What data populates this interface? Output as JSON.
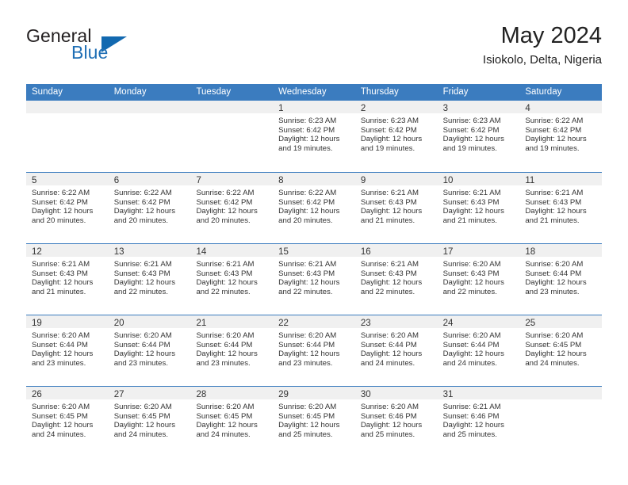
{
  "brand": {
    "word_general": "General",
    "word_blue": "Blue",
    "triangle_color": "#1269b0",
    "blue_color": "#1f6fb5"
  },
  "header": {
    "title": "May 2024",
    "location": "Isiokolo, Delta, Nigeria"
  },
  "theme": {
    "header_blue": "#3b7cbf",
    "daynum_band": "#f0f0f0",
    "text": "#333333"
  },
  "calendar": {
    "weekday_headers": [
      "Sunday",
      "Monday",
      "Tuesday",
      "Wednesday",
      "Thursday",
      "Friday",
      "Saturday"
    ],
    "weeks": [
      [
        {
          "day": "",
          "sunrise": "",
          "sunset": "",
          "daylight1": "",
          "daylight2": ""
        },
        {
          "day": "",
          "sunrise": "",
          "sunset": "",
          "daylight1": "",
          "daylight2": ""
        },
        {
          "day": "",
          "sunrise": "",
          "sunset": "",
          "daylight1": "",
          "daylight2": ""
        },
        {
          "day": "1",
          "sunrise": "Sunrise: 6:23 AM",
          "sunset": "Sunset: 6:42 PM",
          "daylight1": "Daylight: 12 hours",
          "daylight2": "and 19 minutes."
        },
        {
          "day": "2",
          "sunrise": "Sunrise: 6:23 AM",
          "sunset": "Sunset: 6:42 PM",
          "daylight1": "Daylight: 12 hours",
          "daylight2": "and 19 minutes."
        },
        {
          "day": "3",
          "sunrise": "Sunrise: 6:23 AM",
          "sunset": "Sunset: 6:42 PM",
          "daylight1": "Daylight: 12 hours",
          "daylight2": "and 19 minutes."
        },
        {
          "day": "4",
          "sunrise": "Sunrise: 6:22 AM",
          "sunset": "Sunset: 6:42 PM",
          "daylight1": "Daylight: 12 hours",
          "daylight2": "and 19 minutes."
        }
      ],
      [
        {
          "day": "5",
          "sunrise": "Sunrise: 6:22 AM",
          "sunset": "Sunset: 6:42 PM",
          "daylight1": "Daylight: 12 hours",
          "daylight2": "and 20 minutes."
        },
        {
          "day": "6",
          "sunrise": "Sunrise: 6:22 AM",
          "sunset": "Sunset: 6:42 PM",
          "daylight1": "Daylight: 12 hours",
          "daylight2": "and 20 minutes."
        },
        {
          "day": "7",
          "sunrise": "Sunrise: 6:22 AM",
          "sunset": "Sunset: 6:42 PM",
          "daylight1": "Daylight: 12 hours",
          "daylight2": "and 20 minutes."
        },
        {
          "day": "8",
          "sunrise": "Sunrise: 6:22 AM",
          "sunset": "Sunset: 6:42 PM",
          "daylight1": "Daylight: 12 hours",
          "daylight2": "and 20 minutes."
        },
        {
          "day": "9",
          "sunrise": "Sunrise: 6:21 AM",
          "sunset": "Sunset: 6:43 PM",
          "daylight1": "Daylight: 12 hours",
          "daylight2": "and 21 minutes."
        },
        {
          "day": "10",
          "sunrise": "Sunrise: 6:21 AM",
          "sunset": "Sunset: 6:43 PM",
          "daylight1": "Daylight: 12 hours",
          "daylight2": "and 21 minutes."
        },
        {
          "day": "11",
          "sunrise": "Sunrise: 6:21 AM",
          "sunset": "Sunset: 6:43 PM",
          "daylight1": "Daylight: 12 hours",
          "daylight2": "and 21 minutes."
        }
      ],
      [
        {
          "day": "12",
          "sunrise": "Sunrise: 6:21 AM",
          "sunset": "Sunset: 6:43 PM",
          "daylight1": "Daylight: 12 hours",
          "daylight2": "and 21 minutes."
        },
        {
          "day": "13",
          "sunrise": "Sunrise: 6:21 AM",
          "sunset": "Sunset: 6:43 PM",
          "daylight1": "Daylight: 12 hours",
          "daylight2": "and 22 minutes."
        },
        {
          "day": "14",
          "sunrise": "Sunrise: 6:21 AM",
          "sunset": "Sunset: 6:43 PM",
          "daylight1": "Daylight: 12 hours",
          "daylight2": "and 22 minutes."
        },
        {
          "day": "15",
          "sunrise": "Sunrise: 6:21 AM",
          "sunset": "Sunset: 6:43 PM",
          "daylight1": "Daylight: 12 hours",
          "daylight2": "and 22 minutes."
        },
        {
          "day": "16",
          "sunrise": "Sunrise: 6:21 AM",
          "sunset": "Sunset: 6:43 PM",
          "daylight1": "Daylight: 12 hours",
          "daylight2": "and 22 minutes."
        },
        {
          "day": "17",
          "sunrise": "Sunrise: 6:20 AM",
          "sunset": "Sunset: 6:43 PM",
          "daylight1": "Daylight: 12 hours",
          "daylight2": "and 22 minutes."
        },
        {
          "day": "18",
          "sunrise": "Sunrise: 6:20 AM",
          "sunset": "Sunset: 6:44 PM",
          "daylight1": "Daylight: 12 hours",
          "daylight2": "and 23 minutes."
        }
      ],
      [
        {
          "day": "19",
          "sunrise": "Sunrise: 6:20 AM",
          "sunset": "Sunset: 6:44 PM",
          "daylight1": "Daylight: 12 hours",
          "daylight2": "and 23 minutes."
        },
        {
          "day": "20",
          "sunrise": "Sunrise: 6:20 AM",
          "sunset": "Sunset: 6:44 PM",
          "daylight1": "Daylight: 12 hours",
          "daylight2": "and 23 minutes."
        },
        {
          "day": "21",
          "sunrise": "Sunrise: 6:20 AM",
          "sunset": "Sunset: 6:44 PM",
          "daylight1": "Daylight: 12 hours",
          "daylight2": "and 23 minutes."
        },
        {
          "day": "22",
          "sunrise": "Sunrise: 6:20 AM",
          "sunset": "Sunset: 6:44 PM",
          "daylight1": "Daylight: 12 hours",
          "daylight2": "and 23 minutes."
        },
        {
          "day": "23",
          "sunrise": "Sunrise: 6:20 AM",
          "sunset": "Sunset: 6:44 PM",
          "daylight1": "Daylight: 12 hours",
          "daylight2": "and 24 minutes."
        },
        {
          "day": "24",
          "sunrise": "Sunrise: 6:20 AM",
          "sunset": "Sunset: 6:44 PM",
          "daylight1": "Daylight: 12 hours",
          "daylight2": "and 24 minutes."
        },
        {
          "day": "25",
          "sunrise": "Sunrise: 6:20 AM",
          "sunset": "Sunset: 6:45 PM",
          "daylight1": "Daylight: 12 hours",
          "daylight2": "and 24 minutes."
        }
      ],
      [
        {
          "day": "26",
          "sunrise": "Sunrise: 6:20 AM",
          "sunset": "Sunset: 6:45 PM",
          "daylight1": "Daylight: 12 hours",
          "daylight2": "and 24 minutes."
        },
        {
          "day": "27",
          "sunrise": "Sunrise: 6:20 AM",
          "sunset": "Sunset: 6:45 PM",
          "daylight1": "Daylight: 12 hours",
          "daylight2": "and 24 minutes."
        },
        {
          "day": "28",
          "sunrise": "Sunrise: 6:20 AM",
          "sunset": "Sunset: 6:45 PM",
          "daylight1": "Daylight: 12 hours",
          "daylight2": "and 24 minutes."
        },
        {
          "day": "29",
          "sunrise": "Sunrise: 6:20 AM",
          "sunset": "Sunset: 6:45 PM",
          "daylight1": "Daylight: 12 hours",
          "daylight2": "and 25 minutes."
        },
        {
          "day": "30",
          "sunrise": "Sunrise: 6:20 AM",
          "sunset": "Sunset: 6:46 PM",
          "daylight1": "Daylight: 12 hours",
          "daylight2": "and 25 minutes."
        },
        {
          "day": "31",
          "sunrise": "Sunrise: 6:21 AM",
          "sunset": "Sunset: 6:46 PM",
          "daylight1": "Daylight: 12 hours",
          "daylight2": "and 25 minutes."
        },
        {
          "day": "",
          "sunrise": "",
          "sunset": "",
          "daylight1": "",
          "daylight2": ""
        }
      ]
    ]
  }
}
